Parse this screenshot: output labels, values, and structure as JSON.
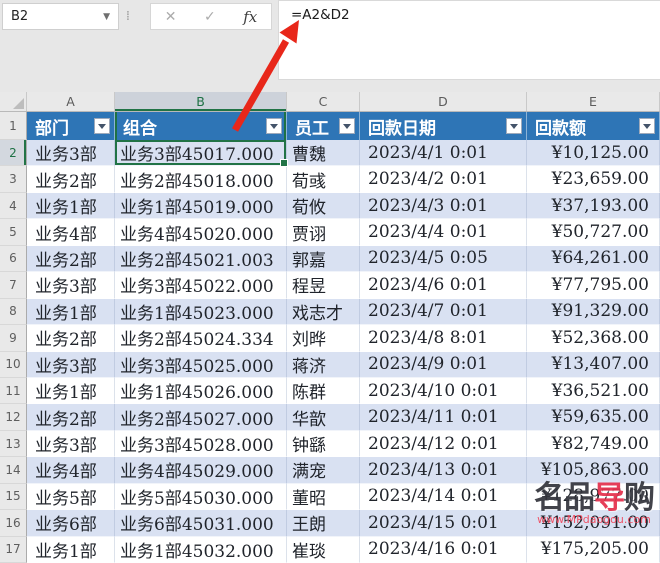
{
  "name_box": {
    "value": "B2"
  },
  "formula_bar": {
    "cancel_label": "✕",
    "enter_label": "✓",
    "fx_label": "fx",
    "formula": "=A2&D2"
  },
  "grid": {
    "column_letters": [
      "A",
      "B",
      "C",
      "D",
      "E"
    ],
    "selected_column": "B",
    "selected_cell": "B2",
    "selected_row": "2",
    "header_row_number": "1",
    "headers": [
      {
        "label": "部门"
      },
      {
        "label": "组合"
      },
      {
        "label": "员工"
      },
      {
        "label": "回款日期"
      },
      {
        "label": "回款额"
      }
    ],
    "rows": [
      {
        "num": "2",
        "dept": "业务3部",
        "combo": "业务3部45017.000",
        "emp": "曹魏",
        "date": "2023/4/1 0:01",
        "amount": "¥10,125.00"
      },
      {
        "num": "3",
        "dept": "业务2部",
        "combo": "业务2部45018.000",
        "emp": "荀彧",
        "date": "2023/4/2 0:01",
        "amount": "¥23,659.00"
      },
      {
        "num": "4",
        "dept": "业务1部",
        "combo": "业务1部45019.000",
        "emp": "荀攸",
        "date": "2023/4/3 0:01",
        "amount": "¥37,193.00"
      },
      {
        "num": "5",
        "dept": "业务4部",
        "combo": "业务4部45020.000",
        "emp": "贾诩",
        "date": "2023/4/4 0:01",
        "amount": "¥50,727.00"
      },
      {
        "num": "6",
        "dept": "业务2部",
        "combo": "业务2部45021.003",
        "emp": "郭嘉",
        "date": "2023/4/5 0:05",
        "amount": "¥64,261.00"
      },
      {
        "num": "7",
        "dept": "业务3部",
        "combo": "业务3部45022.000",
        "emp": "程昱",
        "date": "2023/4/6 0:01",
        "amount": "¥77,795.00"
      },
      {
        "num": "8",
        "dept": "业务1部",
        "combo": "业务1部45023.000",
        "emp": "戏志才",
        "date": "2023/4/7 0:01",
        "amount": "¥91,329.00"
      },
      {
        "num": "9",
        "dept": "业务2部",
        "combo": "业务2部45024.334",
        "emp": "刘晔",
        "date": "2023/4/8 8:01",
        "amount": "¥52,368.00"
      },
      {
        "num": "10",
        "dept": "业务3部",
        "combo": "业务3部45025.000",
        "emp": "蒋济",
        "date": "2023/4/9 0:01",
        "amount": "¥13,407.00"
      },
      {
        "num": "11",
        "dept": "业务1部",
        "combo": "业务1部45026.000",
        "emp": "陈群",
        "date": "2023/4/10 0:01",
        "amount": "¥36,521.00"
      },
      {
        "num": "12",
        "dept": "业务2部",
        "combo": "业务2部45027.000",
        "emp": "华歆",
        "date": "2023/4/11 0:01",
        "amount": "¥59,635.00"
      },
      {
        "num": "13",
        "dept": "业务3部",
        "combo": "业务3部45028.000",
        "emp": "钟繇",
        "date": "2023/4/12 0:01",
        "amount": "¥82,749.00"
      },
      {
        "num": "14",
        "dept": "业务4部",
        "combo": "业务4部45029.000",
        "emp": "满宠",
        "date": "2023/4/13 0:01",
        "amount": "¥105,863.00"
      },
      {
        "num": "15",
        "dept": "业务5部",
        "combo": "业务5部45030.000",
        "emp": "董昭",
        "date": "2023/4/14 0:01",
        "amount": "¥128,977.00"
      },
      {
        "num": "16",
        "dept": "业务6部",
        "combo": "业务6部45031.000",
        "emp": "王朗",
        "date": "2023/4/15 0:01",
        "amount": "¥152,091.00"
      },
      {
        "num": "17",
        "dept": "业务1部",
        "combo": "业务1部45032.000",
        "emp": "崔琰",
        "date": "2023/4/16 0:01",
        "amount": "¥175,205.00"
      }
    ]
  },
  "watermark": {
    "logo_part1": "名品",
    "logo_part2": "导",
    "logo_part3": "购",
    "url": "www.MPdaogou.com"
  },
  "colors": {
    "table_header_blue": "#2e75b6",
    "banded_row_blue": "#d9e1f2",
    "selection_green": "#217346",
    "arrow_red": "#e8271a",
    "watermark_red": "#e5304c"
  }
}
